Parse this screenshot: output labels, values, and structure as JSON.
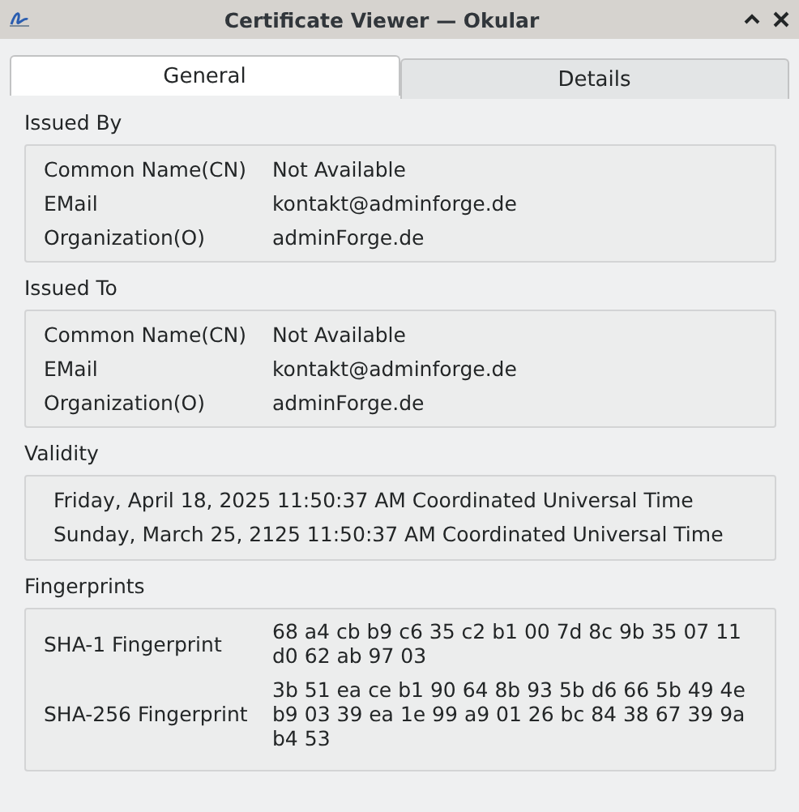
{
  "window": {
    "title": "Certificate Viewer — Okular"
  },
  "tabs": [
    {
      "label": "General",
      "selected": true
    },
    {
      "label": "Details",
      "selected": false
    }
  ],
  "issued_by": {
    "title": "Issued By",
    "rows": [
      {
        "label": "Common Name(CN)",
        "value": "Not Available"
      },
      {
        "label": "EMail",
        "value": "kontakt@adminforge.de"
      },
      {
        "label": "Organization(O)",
        "value": "adminForge.de"
      }
    ]
  },
  "issued_to": {
    "title": "Issued To",
    "rows": [
      {
        "label": "Common Name(CN)",
        "value": "Not Available"
      },
      {
        "label": "EMail",
        "value": "kontakt@adminforge.de"
      },
      {
        "label": "Organization(O)",
        "value": "adminForge.de"
      }
    ]
  },
  "validity": {
    "title": "Validity",
    "lines": [
      "Friday, April 18, 2025 11:50:37 AM Coordinated Universal Time",
      "Sunday, March 25, 2125 11:50:37 AM Coordinated Universal Time"
    ]
  },
  "fingerprints": {
    "title": "Fingerprints",
    "rows": [
      {
        "label": "SHA-1 Fingerprint",
        "lines": [
          "68 a4 cb b9 c6 35 c2 b1 00 7d 8c 9b 35 07 11",
          "d0 62 ab 97 03"
        ]
      },
      {
        "label": "SHA-256 Fingerprint",
        "lines": [
          "3b 51 ea ce b1 90 64 8b 93 5b d6 66 5b 49 4e",
          "b9 03 39 ea 1e 99 a9 01 26 bc 84 38 67 39 9a",
          "b4 53"
        ]
      }
    ]
  }
}
